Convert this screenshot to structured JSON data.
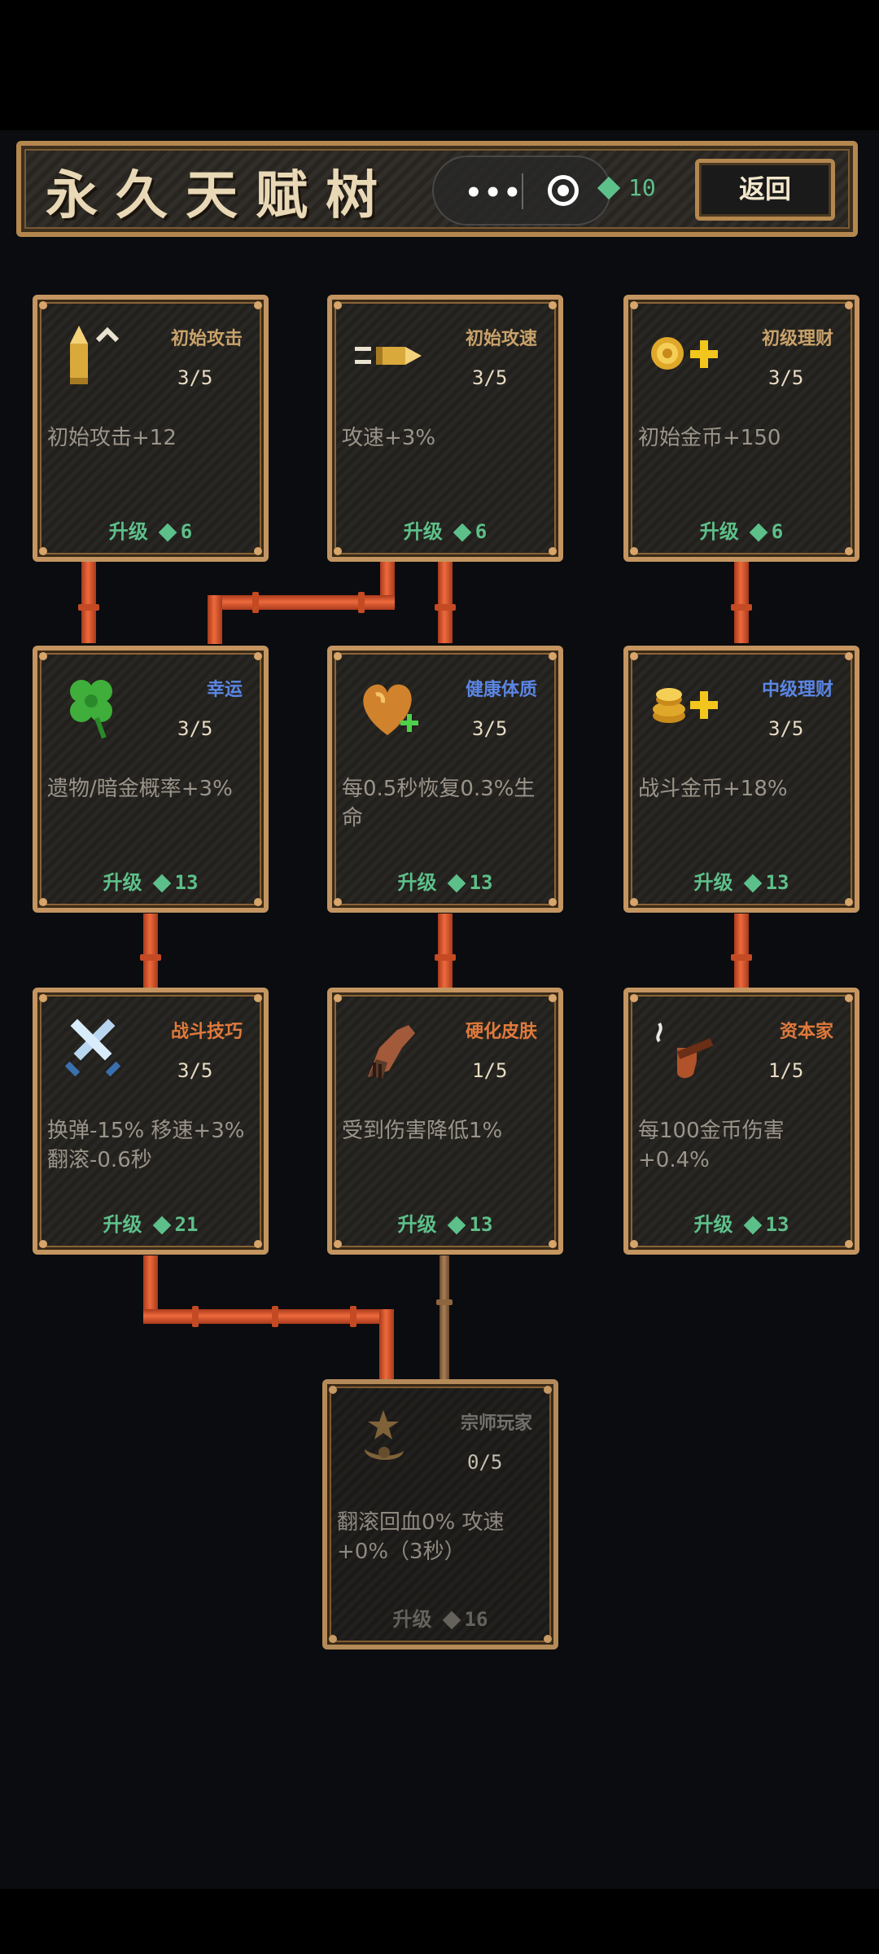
{
  "header": {
    "title": "永久天赋树",
    "gem_count": "10",
    "back_label": "返回"
  },
  "colors": {
    "title_gold": "#c9a36b",
    "title_blue": "#5b86e5",
    "title_orange": "#e07a3c",
    "title_gray": "#7d7a74",
    "green": "#5dc08a",
    "pipe": "#e2582c"
  },
  "talents": [
    {
      "id": "starting-attack",
      "title": "初始攻击",
      "title_color": "#c9a36b",
      "level": "3/5",
      "desc": "初始攻击+12",
      "upgrade_label": "升级",
      "cost": "6",
      "icon": "bullet-up-icon"
    },
    {
      "id": "starting-attack-speed",
      "title": "初始攻速",
      "title_color": "#c9a36b",
      "level": "3/5",
      "desc": "攻速+3%",
      "upgrade_label": "升级",
      "cost": "6",
      "icon": "flying-bullet-icon"
    },
    {
      "id": "basic-finance",
      "title": "初级理财",
      "title_color": "#c9a36b",
      "level": "3/5",
      "desc": "初始金币+150",
      "upgrade_label": "升级",
      "cost": "6",
      "icon": "coin-plus-icon"
    },
    {
      "id": "luck",
      "title": "幸运",
      "title_color": "#5b86e5",
      "level": "3/5",
      "desc": "遗物/暗金概率+3%",
      "upgrade_label": "升级",
      "cost": "13",
      "icon": "clover-icon"
    },
    {
      "id": "healthy-physique",
      "title": "健康体质",
      "title_color": "#5b86e5",
      "level": "3/5",
      "desc": "每0.5秒恢复0.3%生命",
      "upgrade_label": "升级",
      "cost": "13",
      "icon": "heart-plus-icon"
    },
    {
      "id": "intermediate-finance",
      "title": "中级理财",
      "title_color": "#5b86e5",
      "level": "3/5",
      "desc": "战斗金币+18%",
      "upgrade_label": "升级",
      "cost": "13",
      "icon": "coin-stack-plus-icon"
    },
    {
      "id": "combat-skill",
      "title": "战斗技巧",
      "title_color": "#e07a3c",
      "level": "3/5",
      "desc": "换弹-15% 移速+3% 翻滚-0.6秒",
      "upgrade_label": "升级",
      "cost": "21",
      "icon": "crossed-swords-icon"
    },
    {
      "id": "hardened-skin",
      "title": "硬化皮肤",
      "title_color": "#e07a3c",
      "level": "1/5",
      "desc": "受到伤害降低1%",
      "upgrade_label": "升级",
      "cost": "13",
      "icon": "armored-arm-icon"
    },
    {
      "id": "capitalist",
      "title": "资本家",
      "title_color": "#e07a3c",
      "level": "1/5",
      "desc": "每100金币伤害+0.4%",
      "upgrade_label": "升级",
      "cost": "13",
      "icon": "pipe-icon"
    },
    {
      "id": "master-player",
      "title": "宗师玩家",
      "title_color": "#7d7a74",
      "level": "0/5",
      "desc": "翻滚回血0% 攻速+0%（3秒）",
      "upgrade_label": "升级",
      "cost": "16",
      "icon": "star-emblem-icon"
    }
  ]
}
